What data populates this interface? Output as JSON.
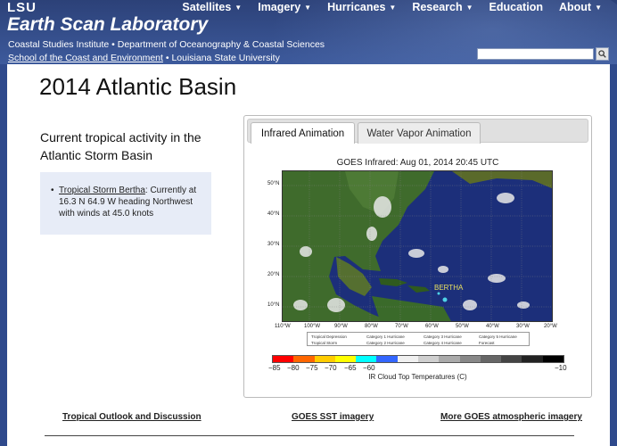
{
  "header": {
    "lsu": "LSU",
    "title": "Earth Scan Laboratory",
    "subtitle1": "Coastal Studies Institute • Department of Oceanography & Coastal Sciences",
    "subtitle2_link": "School of the Coast and Environment",
    "subtitle2_rest": " • Louisiana State University",
    "nav": [
      {
        "label": "Satellites",
        "dropdown": true
      },
      {
        "label": "Imagery",
        "dropdown": true
      },
      {
        "label": "Hurricanes",
        "dropdown": true
      },
      {
        "label": "Research",
        "dropdown": true
      },
      {
        "label": "Education",
        "dropdown": false
      },
      {
        "label": "About",
        "dropdown": true
      }
    ],
    "search_value": ""
  },
  "page": {
    "title": "2014 Atlantic Basin",
    "left_heading": "Current tropical activity in the Atlantic Storm Basin",
    "activity_link": "Tropical Storm Bertha",
    "activity_text": ": Currently at 16.3 N 64.9 W heading Northwest with winds at 45.0 knots"
  },
  "panel": {
    "tabs": [
      "Infrared Animation",
      "Water Vapor Animation"
    ],
    "active_tab": 0,
    "figure_title": "GOES Infrared: Aug 01, 2014 20:45 UTC",
    "storm_label": "BERTHA",
    "lat_labels": [
      "50°N",
      "40°N",
      "30°N",
      "20°N",
      "10°N"
    ],
    "lon_labels": [
      "110°W",
      "100°W",
      "90°W",
      "80°W",
      "70°W",
      "60°W",
      "50°W",
      "40°W",
      "30°W",
      "20°W"
    ],
    "legend": [
      "Tropical Depression",
      "Category 1 Hurricane",
      "Category 3 Hurricane",
      "Category 5 Hurricane",
      "Tropical Storm",
      "Category 2 Hurricane",
      "Category 4 Hurricane",
      "Forecast"
    ],
    "colorbar_ticks": [
      "−85",
      "−80",
      "−75",
      "−70",
      "−65",
      "−60",
      "−10"
    ],
    "colorbar_label": "IR Cloud Top Temperatures (C)",
    "colorbar_colors": [
      "#ff0000",
      "#ff6600",
      "#ffcc00",
      "#ffff00",
      "#00ffff",
      "#3366ff",
      "#f0f0f0",
      "#cfcfcf",
      "#aaaaaa",
      "#888888",
      "#666666",
      "#444444",
      "#222222",
      "#000000"
    ]
  },
  "footer": {
    "links": [
      "Tropical Outlook and Discussion",
      "GOES SST imagery",
      "More GOES atmospheric imagery"
    ]
  },
  "colors": {
    "header_bg": "#2f4a8c",
    "info_box_bg": "#e7ecf7"
  }
}
